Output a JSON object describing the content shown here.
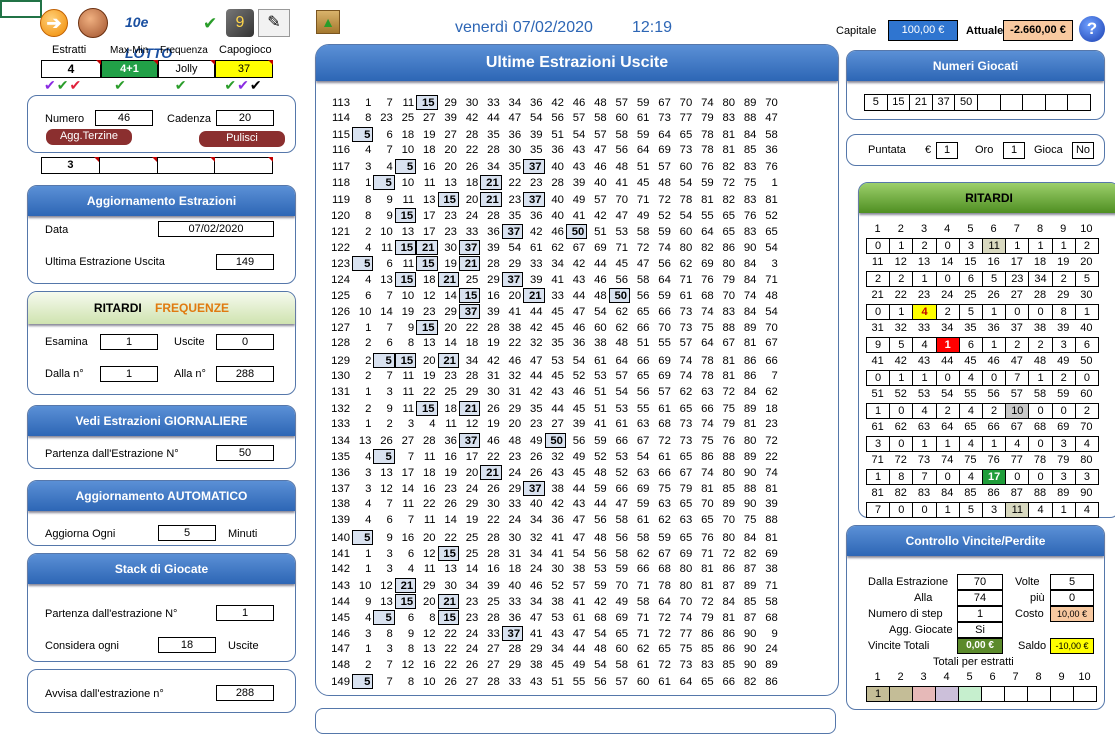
{
  "toolbar": {
    "estratti": "Estratti",
    "maxmin": "Max-Min",
    "frequenza": "Frequenza",
    "capogioco": "Capogioco",
    "estratti_val": "4",
    "maxmin_val": "4+1",
    "frequenza_val": "Jolly",
    "capogioco_val": "37",
    "lotto_brand": "10e LOTTO"
  },
  "header": {
    "date": "venerdì 07/02/2020",
    "time": "12:19",
    "capitale_label": "Capitale",
    "capitale_val": "100,00 €",
    "attuale_label": "Attuale",
    "attuale_val": "-2.660,00 €"
  },
  "numero": {
    "label": "Numero",
    "value": "46",
    "cadenza_label": "Cadenza",
    "cadenza_val": "20",
    "agg_btn": "Agg.Terzine",
    "pulisci_btn": "Pulisci",
    "small_val": "3"
  },
  "aggiornamento": {
    "title": "Aggiornamento  Estrazioni",
    "data_label": "Data",
    "data_val": "07/02/2020",
    "ultima_label": "Ultima Estrazione Uscita",
    "ultima_val": "149"
  },
  "ritardi_panel": {
    "title_a": "RITARDI",
    "title_b": "FREQUENZE",
    "esamina_label": "Esamina",
    "esamina_val": "1",
    "uscite_label": "Uscite",
    "uscite_val": "0",
    "dalla_label": "Dalla n°",
    "dalla_val": "1",
    "alla_label": "Alla n°",
    "alla_val": "288"
  },
  "giornaliere": {
    "title": "Vedi Estrazioni GIORNALIERE",
    "label": "Partenza dall'Estrazione N°",
    "val": "50"
  },
  "automatico": {
    "title": "Aggiornamento  AUTOMATICO",
    "label": "Aggiorna Ogni",
    "val": "5",
    "unit": "Minuti"
  },
  "stack": {
    "title": "Stack di Giocate",
    "partenza_label": "Partenza dall'estrazione N°",
    "partenza_val": "1",
    "considera_label": "Considera ogni",
    "considera_val": "18",
    "considera_unit": "Uscite"
  },
  "avvisa": {
    "label": "Avvisa dall'estrazione n°",
    "val": "288"
  },
  "estrazioni": {
    "title": "Ultime Estrazioni Uscite",
    "rows": [
      [
        "113",
        "1",
        "7",
        "11",
        "15",
        "29",
        "30",
        "33",
        "34",
        "36",
        "42",
        "46",
        "48",
        "57",
        "59",
        "67",
        "70",
        "74",
        "80",
        "89",
        "70"
      ],
      [
        "114",
        "8",
        "23",
        "25",
        "27",
        "39",
        "42",
        "44",
        "47",
        "54",
        "56",
        "57",
        "58",
        "60",
        "61",
        "73",
        "77",
        "79",
        "83",
        "88",
        "47"
      ],
      [
        "115",
        "5",
        "6",
        "18",
        "19",
        "27",
        "28",
        "35",
        "36",
        "39",
        "51",
        "54",
        "57",
        "58",
        "59",
        "64",
        "65",
        "78",
        "81",
        "84",
        "58"
      ],
      [
        "116",
        "4",
        "7",
        "10",
        "18",
        "20",
        "22",
        "28",
        "30",
        "35",
        "36",
        "43",
        "47",
        "56",
        "64",
        "69",
        "73",
        "78",
        "81",
        "85",
        "36"
      ],
      [
        "117",
        "3",
        "4",
        "5",
        "16",
        "20",
        "26",
        "34",
        "35",
        "37",
        "40",
        "43",
        "46",
        "48",
        "51",
        "57",
        "60",
        "76",
        "82",
        "83",
        "76"
      ],
      [
        "118",
        "1",
        "5",
        "10",
        "11",
        "13",
        "18",
        "21",
        "22",
        "23",
        "28",
        "39",
        "40",
        "41",
        "45",
        "48",
        "54",
        "59",
        "72",
        "75",
        "1"
      ],
      [
        "119",
        "8",
        "9",
        "11",
        "13",
        "15",
        "20",
        "21",
        "23",
        "37",
        "40",
        "49",
        "57",
        "70",
        "71",
        "72",
        "78",
        "81",
        "82",
        "83",
        "81"
      ],
      [
        "120",
        "8",
        "9",
        "15",
        "17",
        "23",
        "24",
        "28",
        "35",
        "36",
        "40",
        "41",
        "42",
        "47",
        "49",
        "52",
        "54",
        "55",
        "65",
        "76",
        "52"
      ],
      [
        "121",
        "2",
        "10",
        "13",
        "17",
        "23",
        "33",
        "36",
        "37",
        "42",
        "46",
        "50",
        "51",
        "53",
        "58",
        "59",
        "60",
        "64",
        "65",
        "83",
        "65"
      ],
      [
        "122",
        "4",
        "11",
        "15",
        "21",
        "30",
        "37",
        "39",
        "54",
        "61",
        "62",
        "67",
        "69",
        "71",
        "72",
        "74",
        "80",
        "82",
        "86",
        "90",
        "54"
      ],
      [
        "123",
        "5",
        "6",
        "11",
        "15",
        "19",
        "21",
        "28",
        "29",
        "33",
        "34",
        "42",
        "44",
        "45",
        "47",
        "56",
        "62",
        "69",
        "80",
        "84",
        "3"
      ],
      [
        "124",
        "4",
        "13",
        "15",
        "18",
        "21",
        "25",
        "29",
        "37",
        "39",
        "41",
        "43",
        "46",
        "56",
        "58",
        "64",
        "71",
        "76",
        "79",
        "84",
        "71"
      ],
      [
        "125",
        "6",
        "7",
        "10",
        "12",
        "14",
        "15",
        "16",
        "20",
        "21",
        "33",
        "44",
        "48",
        "50",
        "56",
        "59",
        "61",
        "68",
        "70",
        "74",
        "48"
      ],
      [
        "126",
        "10",
        "14",
        "19",
        "23",
        "29",
        "37",
        "39",
        "41",
        "44",
        "45",
        "47",
        "54",
        "62",
        "65",
        "66",
        "73",
        "74",
        "83",
        "84",
        "54"
      ],
      [
        "127",
        "1",
        "7",
        "9",
        "15",
        "20",
        "22",
        "28",
        "38",
        "42",
        "45",
        "46",
        "60",
        "62",
        "66",
        "70",
        "73",
        "75",
        "88",
        "89",
        "70"
      ],
      [
        "128",
        "2",
        "6",
        "8",
        "13",
        "14",
        "18",
        "19",
        "22",
        "32",
        "35",
        "36",
        "38",
        "48",
        "51",
        "55",
        "57",
        "64",
        "67",
        "81",
        "67"
      ],
      [
        "129",
        "2",
        "5",
        "15",
        "20",
        "21",
        "34",
        "42",
        "46",
        "47",
        "53",
        "54",
        "61",
        "64",
        "66",
        "69",
        "74",
        "78",
        "81",
        "86",
        "66"
      ],
      [
        "130",
        "2",
        "7",
        "11",
        "19",
        "23",
        "28",
        "31",
        "32",
        "44",
        "45",
        "52",
        "53",
        "57",
        "65",
        "69",
        "74",
        "78",
        "81",
        "86",
        "7"
      ],
      [
        "131",
        "1",
        "3",
        "11",
        "22",
        "25",
        "29",
        "30",
        "31",
        "42",
        "43",
        "46",
        "51",
        "54",
        "56",
        "57",
        "62",
        "63",
        "72",
        "84",
        "62"
      ],
      [
        "132",
        "2",
        "9",
        "11",
        "15",
        "18",
        "21",
        "26",
        "29",
        "35",
        "44",
        "45",
        "51",
        "53",
        "55",
        "61",
        "65",
        "66",
        "75",
        "89",
        "18"
      ],
      [
        "133",
        "1",
        "2",
        "3",
        "4",
        "11",
        "12",
        "19",
        "20",
        "23",
        "27",
        "39",
        "41",
        "61",
        "63",
        "68",
        "73",
        "74",
        "79",
        "81",
        "23"
      ],
      [
        "134",
        "13",
        "26",
        "27",
        "28",
        "36",
        "37",
        "46",
        "48",
        "49",
        "50",
        "56",
        "59",
        "66",
        "67",
        "72",
        "73",
        "75",
        "76",
        "80",
        "72"
      ],
      [
        "135",
        "4",
        "5",
        "7",
        "11",
        "16",
        "17",
        "22",
        "23",
        "26",
        "32",
        "49",
        "52",
        "53",
        "54",
        "61",
        "65",
        "86",
        "88",
        "89",
        "22"
      ],
      [
        "136",
        "3",
        "13",
        "17",
        "18",
        "19",
        "20",
        "21",
        "24",
        "26",
        "43",
        "45",
        "48",
        "52",
        "63",
        "66",
        "67",
        "74",
        "80",
        "90",
        "74"
      ],
      [
        "137",
        "3",
        "12",
        "14",
        "16",
        "23",
        "24",
        "26",
        "29",
        "37",
        "38",
        "44",
        "59",
        "66",
        "69",
        "75",
        "79",
        "81",
        "85",
        "88",
        "81"
      ],
      [
        "138",
        "4",
        "7",
        "11",
        "22",
        "26",
        "29",
        "30",
        "33",
        "40",
        "42",
        "43",
        "44",
        "47",
        "59",
        "63",
        "65",
        "70",
        "89",
        "90",
        "39"
      ],
      [
        "139",
        "4",
        "6",
        "7",
        "11",
        "14",
        "19",
        "22",
        "24",
        "34",
        "36",
        "47",
        "56",
        "58",
        "61",
        "62",
        "63",
        "65",
        "70",
        "75",
        "88"
      ],
      [
        "140",
        "5",
        "9",
        "16",
        "20",
        "22",
        "25",
        "28",
        "30",
        "32",
        "41",
        "47",
        "48",
        "56",
        "58",
        "59",
        "65",
        "76",
        "80",
        "84",
        "81"
      ],
      [
        "141",
        "1",
        "3",
        "6",
        "12",
        "15",
        "25",
        "28",
        "31",
        "34",
        "41",
        "54",
        "56",
        "58",
        "62",
        "67",
        "69",
        "71",
        "72",
        "82",
        "69"
      ],
      [
        "142",
        "1",
        "3",
        "4",
        "11",
        "13",
        "14",
        "16",
        "18",
        "24",
        "30",
        "38",
        "53",
        "59",
        "66",
        "68",
        "80",
        "81",
        "86",
        "87",
        "38"
      ],
      [
        "143",
        "10",
        "12",
        "21",
        "29",
        "30",
        "34",
        "39",
        "40",
        "46",
        "52",
        "57",
        "59",
        "70",
        "71",
        "78",
        "80",
        "81",
        "87",
        "89",
        "71"
      ],
      [
        "144",
        "9",
        "13",
        "15",
        "20",
        "21",
        "23",
        "25",
        "33",
        "34",
        "38",
        "41",
        "42",
        "49",
        "58",
        "64",
        "70",
        "72",
        "84",
        "85",
        "58"
      ],
      [
        "145",
        "4",
        "5",
        "6",
        "8",
        "15",
        "23",
        "28",
        "36",
        "47",
        "53",
        "61",
        "68",
        "69",
        "71",
        "72",
        "74",
        "79",
        "81",
        "87",
        "68"
      ],
      [
        "146",
        "3",
        "8",
        "9",
        "12",
        "22",
        "24",
        "33",
        "37",
        "41",
        "43",
        "47",
        "54",
        "65",
        "71",
        "72",
        "77",
        "86",
        "86",
        "90",
        "9"
      ],
      [
        "147",
        "1",
        "3",
        "8",
        "13",
        "22",
        "24",
        "27",
        "28",
        "29",
        "34",
        "44",
        "48",
        "60",
        "62",
        "65",
        "75",
        "85",
        "86",
        "90",
        "24"
      ],
      [
        "148",
        "2",
        "7",
        "12",
        "16",
        "22",
        "26",
        "27",
        "29",
        "38",
        "45",
        "49",
        "54",
        "58",
        "61",
        "72",
        "73",
        "83",
        "85",
        "90",
        "89"
      ],
      [
        "149",
        "5",
        "7",
        "8",
        "10",
        "26",
        "27",
        "28",
        "33",
        "43",
        "51",
        "55",
        "56",
        "57",
        "60",
        "61",
        "64",
        "65",
        "66",
        "82",
        "86",
        "64"
      ]
    ]
  },
  "numeri_giocati": {
    "title": "Numeri Giocati",
    "values": [
      "5",
      "15",
      "21",
      "37",
      "50",
      "",
      "",
      "",
      "",
      ""
    ]
  },
  "puntata": {
    "puntata_label": "Puntata",
    "currency": "€",
    "puntata_val": "1",
    "oro_label": "Oro",
    "oro_val": "1",
    "gioca_label": "Gioca",
    "gioca_val": "No"
  },
  "ritardi": {
    "title": "RITARDI",
    "rows": [
      {
        "nums": [
          "1",
          "2",
          "3",
          "4",
          "5",
          "6",
          "7",
          "8",
          "9",
          "10"
        ],
        "vals": [
          "0",
          "1",
          "2",
          "0",
          "3",
          "11",
          "1",
          "1",
          "1",
          "2"
        ]
      },
      {
        "nums": [
          "11",
          "12",
          "13",
          "14",
          "15",
          "16",
          "17",
          "18",
          "19",
          "20"
        ],
        "vals": [
          "2",
          "2",
          "1",
          "0",
          "6",
          "5",
          "23",
          "34",
          "2",
          "5"
        ]
      },
      {
        "nums": [
          "21",
          "22",
          "23",
          "24",
          "25",
          "26",
          "27",
          "28",
          "29",
          "30"
        ],
        "vals": [
          "0",
          "1",
          "4",
          "2",
          "5",
          "1",
          "0",
          "0",
          "8",
          "1"
        ]
      },
      {
        "nums": [
          "31",
          "32",
          "33",
          "34",
          "35",
          "36",
          "37",
          "38",
          "39",
          "40"
        ],
        "vals": [
          "9",
          "5",
          "4",
          "1",
          "6",
          "1",
          "2",
          "2",
          "3",
          "6"
        ]
      },
      {
        "nums": [
          "41",
          "42",
          "43",
          "44",
          "45",
          "46",
          "47",
          "48",
          "49",
          "50"
        ],
        "vals": [
          "0",
          "1",
          "1",
          "0",
          "4",
          "0",
          "7",
          "1",
          "2",
          "0"
        ]
      },
      {
        "nums": [
          "51",
          "52",
          "53",
          "54",
          "55",
          "56",
          "57",
          "58",
          "59",
          "60"
        ],
        "vals": [
          "1",
          "0",
          "4",
          "2",
          "4",
          "2",
          "10",
          "0",
          "0",
          "2"
        ]
      },
      {
        "nums": [
          "61",
          "62",
          "63",
          "64",
          "65",
          "66",
          "67",
          "68",
          "69",
          "70"
        ],
        "vals": [
          "3",
          "0",
          "1",
          "1",
          "4",
          "1",
          "4",
          "0",
          "3",
          "4"
        ]
      },
      {
        "nums": [
          "71",
          "72",
          "73",
          "74",
          "75",
          "76",
          "77",
          "78",
          "79",
          "80"
        ],
        "vals": [
          "1",
          "8",
          "7",
          "0",
          "4",
          "17",
          "0",
          "0",
          "3",
          "3"
        ]
      },
      {
        "nums": [
          "81",
          "82",
          "83",
          "84",
          "85",
          "86",
          "87",
          "88",
          "89",
          "90"
        ],
        "vals": [
          "7",
          "0",
          "0",
          "1",
          "5",
          "3",
          "11",
          "4",
          "1",
          "4"
        ]
      }
    ]
  },
  "controllo": {
    "title": "Controllo  Vincite/Perdite",
    "dalla_label": "Dalla Estrazione",
    "dalla_val": "70",
    "volte_label": "Volte",
    "volte_val": "5",
    "alla_label": "Alla",
    "alla_val": "74",
    "piu_label": "più",
    "piu_val": "0",
    "step_label": "Numero di step",
    "step_val": "1",
    "costo_label": "Costo",
    "costo_val": "10,00 €",
    "agg_label": "Agg. Giocate",
    "agg_val": "Si",
    "vincite_label": "Vincite Totali",
    "vincite_val": "0,00 €",
    "saldo_label": "Saldo",
    "saldo_val": "-10,00 €",
    "totali_label": "Totali per estratti",
    "totali_nums": [
      "1",
      "2",
      "3",
      "4",
      "5",
      "6",
      "7",
      "8",
      "9",
      "10"
    ],
    "totali_vals": [
      "1",
      "",
      "",
      "",
      "",
      "",
      "",
      "",
      "",
      ""
    ]
  }
}
